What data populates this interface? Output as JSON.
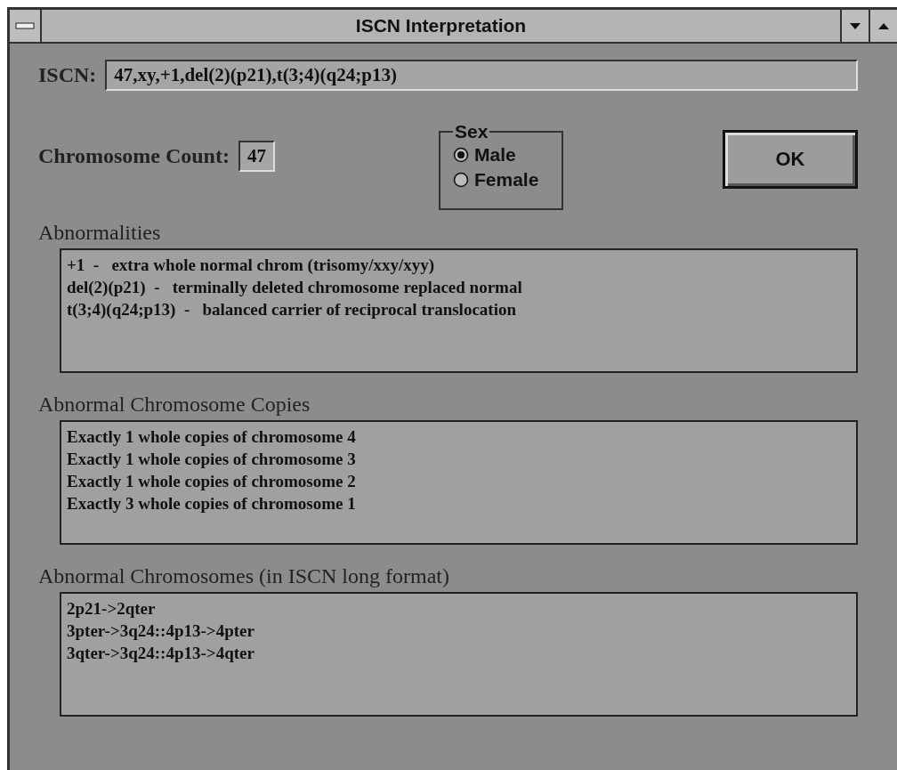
{
  "window": {
    "title": "ISCN Interpretation"
  },
  "iscn": {
    "label": "ISCN:",
    "value": "47,xy,+1,del(2)(p21),t(3;4)(q24;p13)"
  },
  "chromosome_count": {
    "label": "Chromosome Count:",
    "value": "47"
  },
  "sex": {
    "label": "Sex",
    "options": [
      {
        "label": "Male",
        "selected": true
      },
      {
        "label": "Female",
        "selected": false
      }
    ]
  },
  "ok_button": "OK",
  "lists": [
    {
      "title": "Abnormalities",
      "items": [
        "+1  -   extra whole normal chrom (trisomy/xxy/xyy)",
        "del(2)(p21)  -   terminally deleted chromosome replaced normal",
        "t(3;4)(q24;p13)  -   balanced carrier of reciprocal translocation"
      ]
    },
    {
      "title": "Abnormal Chromosome Copies",
      "items": [
        "Exactly 1 whole copies of chromosome 4",
        "Exactly 1 whole copies of chromosome 3",
        "Exactly 1 whole copies of chromosome 2",
        "Exactly 3 whole copies of chromosome 1"
      ]
    },
    {
      "title": "Abnormal Chromosomes (in ISCN long format)",
      "items": [
        "2p21->2qter",
        "3pter->3q24::4p13->4pter",
        "3qter->3q24::4p13->4qter"
      ]
    }
  ]
}
